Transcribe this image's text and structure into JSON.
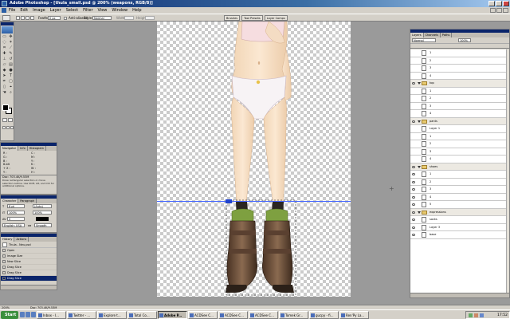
{
  "window": {
    "title": "Adobe Photoshop - [thula_small.psd @ 200% (weapons, RGB/8)]"
  },
  "menu": [
    "File",
    "Edit",
    "Image",
    "Layer",
    "Select",
    "Filter",
    "View",
    "Window",
    "Help"
  ],
  "options_bar": {
    "feather_label": "Feather:",
    "feather_value": "0 px",
    "antialias_label": "Anti-aliased",
    "style_label": "Style:",
    "style_value": "Normal",
    "width_label": "Width:",
    "height_label": "Height:",
    "palette_tabs": [
      "Brushes",
      "Tool Presets",
      "Layer Comps"
    ]
  },
  "navigator": {
    "tabs": [
      "Navigator",
      "Info",
      "Histogram"
    ],
    "info_rows": [
      {
        "left": "R :",
        "right": "C :"
      },
      {
        "left": "G :",
        "right": "M :"
      },
      {
        "left": "B :",
        "right": "Y :"
      },
      {
        "left": "8-bit",
        "right": "K :"
      },
      {
        "left": "+ X :",
        "right": "W :"
      },
      {
        "left": "Y :",
        "right": "H :"
      }
    ],
    "doc_info": "Doc: 703.4K/9.53M",
    "tip": "Draw rectangular selection or move selection outline. Use Shift, Alt, and Ctrl for additional options."
  },
  "character": {
    "tabs": [
      "Character",
      "Paragraph"
    ],
    "font_size": "8 pt",
    "leading": "(Auto)",
    "tracking": "0",
    "vertical_scale": "100%",
    "horizontal_scale": "100%",
    "language": "English: USA",
    "antialias": "Smooth"
  },
  "history": {
    "tabs": [
      "History",
      "Actions"
    ],
    "snapshot": "Thula - Neu.psd",
    "items": [
      "Open",
      "Image Size",
      "New Slice",
      "Drag Slice",
      "Drag Slice",
      "Drag Slice"
    ],
    "active_index": 5
  },
  "layers": {
    "tabs": [
      "Layers",
      "Channels",
      "Paths"
    ],
    "blend_mode": "Normal",
    "opacity": "100%",
    "fill": "100%",
    "rows": [
      {
        "type": "layer",
        "name": "1",
        "visible": false
      },
      {
        "type": "layer",
        "name": "2",
        "visible": false
      },
      {
        "type": "layer",
        "name": "3",
        "visible": false
      },
      {
        "type": "layer",
        "name": "4",
        "visible": false
      },
      {
        "type": "group",
        "name": "top",
        "visible": true
      },
      {
        "type": "layer",
        "name": "1",
        "visible": false
      },
      {
        "type": "layer",
        "name": "2",
        "visible": false
      },
      {
        "type": "layer",
        "name": "3",
        "visible": false
      },
      {
        "type": "layer",
        "name": "4",
        "visible": false
      },
      {
        "type": "group",
        "name": "pants",
        "visible": true
      },
      {
        "type": "layer",
        "name": "Layer 1",
        "visible": false
      },
      {
        "type": "layer",
        "name": "1",
        "visible": false
      },
      {
        "type": "layer",
        "name": "2",
        "visible": false
      },
      {
        "type": "layer",
        "name": "3",
        "visible": false
      },
      {
        "type": "layer",
        "name": "4",
        "visible": false
      },
      {
        "type": "group",
        "name": "shoes",
        "visible": true
      },
      {
        "type": "layer",
        "name": "1",
        "visible": true
      },
      {
        "type": "layer",
        "name": "2",
        "visible": true
      },
      {
        "type": "layer",
        "name": "3",
        "visible": true
      },
      {
        "type": "layer",
        "name": "4",
        "visible": true
      },
      {
        "type": "layer",
        "name": "5",
        "visible": true
      },
      {
        "type": "group",
        "name": "expressions",
        "visible": true
      },
      {
        "type": "layer",
        "name": "socks",
        "visible": true
      },
      {
        "type": "layer",
        "name": "Layer 3",
        "visible": true
      },
      {
        "type": "layer",
        "name": "base",
        "visible": true
      }
    ]
  },
  "status_bar": {
    "zoom": "200%",
    "doc": "Doc: 703.4K/9.53M"
  },
  "taskbar": {
    "start": "Start",
    "tasks": [
      {
        "label": "Inbox - I...",
        "active": false
      },
      {
        "label": "Twitter - ...",
        "active": false
      },
      {
        "label": "Explore t...",
        "active": false
      },
      {
        "label": "Total Co...",
        "active": false
      },
      {
        "label": "Adobe P...",
        "active": true
      },
      {
        "label": "ACDSee C...",
        "active": false
      },
      {
        "label": "ACDSee C...",
        "active": false
      },
      {
        "label": "ACDSee C...",
        "active": false
      },
      {
        "label": "Tomek Gr...",
        "active": false
      },
      {
        "label": "gucpy - fi...",
        "active": false
      },
      {
        "label": "Ren'Py La...",
        "active": false
      }
    ],
    "clock": "17:52"
  },
  "colors": {
    "titlebar": "#0a246a",
    "chrome": "#d4d0c8",
    "workspace": "#9a9a9a",
    "guide": "#4466ff",
    "selection": "#2244cc"
  }
}
